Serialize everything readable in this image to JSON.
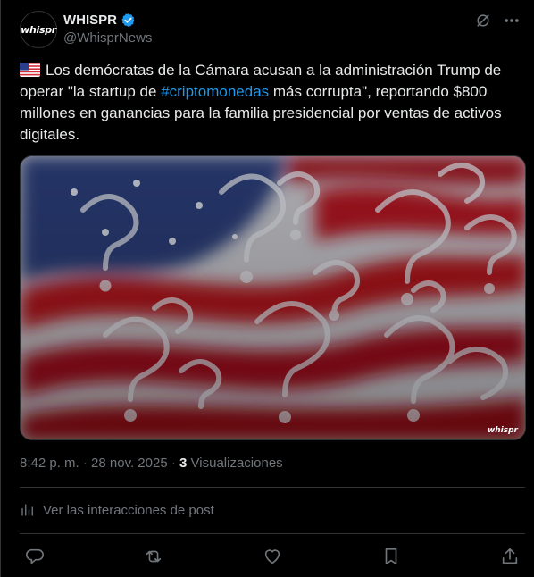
{
  "post": {
    "author": {
      "display_name": "WHISPR",
      "handle": "@WhisprNews",
      "avatar_text": "whispr",
      "verified": true
    },
    "text": {
      "before": "Los demócratas de la Cámara acusan a la administración Trump de operar \"la startup de ",
      "hashtag": "#criptomonedas",
      "after": " más corrupta\", reportando $800 millones en ganancias para la familia presidencial por ventas de activos digitales."
    },
    "media": {
      "watermark": "whispr"
    },
    "meta": {
      "time": "8:42 p. m.",
      "separator1": " · ",
      "date": "28 nov. 2025",
      "separator2": " · ",
      "views_count": "3",
      "views_label": " Visualizaciones"
    },
    "analytics_label": "Ver las interacciones de post"
  },
  "colors": {
    "background": "#000000",
    "text": "#e7e9ea",
    "muted": "#71767b",
    "link": "#1d9bf0",
    "border": "#2f3336"
  },
  "icons": [
    "verified-badge-icon",
    "grok-icon",
    "more-icon",
    "analytics-icon",
    "reply-icon",
    "repost-icon",
    "like-icon",
    "bookmark-icon",
    "share-icon"
  ]
}
